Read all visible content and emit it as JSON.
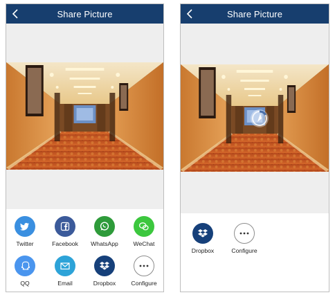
{
  "left_screen": {
    "title": "Share Picture",
    "share_items": [
      {
        "label": "Twitter",
        "icon": "twitter-icon",
        "color": "#3a8fe0"
      },
      {
        "label": "Facebook",
        "icon": "facebook-icon",
        "color": "#3b5a9a"
      },
      {
        "label": "WhatsApp",
        "icon": "whatsapp-icon",
        "color": "#2e9b3a"
      },
      {
        "label": "WeChat",
        "icon": "wechat-icon",
        "color": "#3cc73e"
      },
      {
        "label": "QQ",
        "icon": "qq-icon",
        "color": "#4a95ee"
      },
      {
        "label": "Email",
        "icon": "email-icon",
        "color": "#2da3d8"
      },
      {
        "label": "Dropbox",
        "icon": "dropbox-icon",
        "color": "#16407a"
      },
      {
        "label": "Configure",
        "icon": "more-icon",
        "color": "#ffffff"
      }
    ]
  },
  "right_screen": {
    "title": "Share Picture",
    "share_items": [
      {
        "label": "Dropbox",
        "icon": "dropbox-icon",
        "color": "#16407a"
      },
      {
        "label": "Configure",
        "icon": "more-icon",
        "color": "#ffffff"
      }
    ]
  },
  "colors": {
    "header": "#173e6e",
    "background": "#eeeeee"
  }
}
